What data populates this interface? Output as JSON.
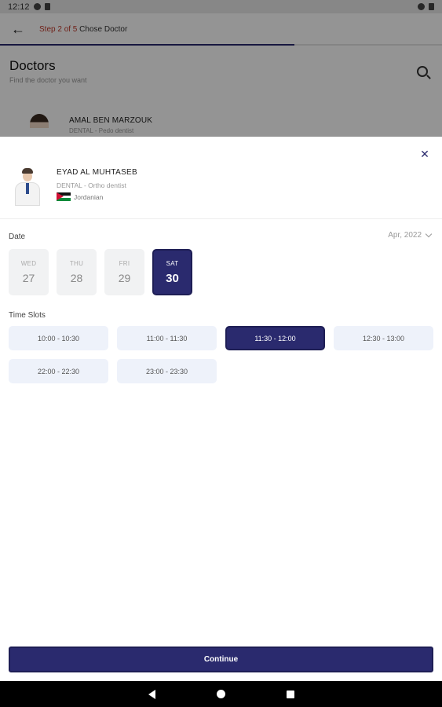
{
  "status_bar": {
    "time": "12:12"
  },
  "top_bar": {
    "step": "Step 2 of 5",
    "step_title": "Chose Doctor"
  },
  "doctors_header": {
    "title": "Doctors",
    "subtitle": "Find the doctor you want"
  },
  "background_doctor": {
    "name": "AMAL BEN MARZOUK",
    "specialty": "DENTAL - Pedo dentist"
  },
  "doctor": {
    "name": "EYAD AL MUHTASEB",
    "specialty": "DENTAL - Ortho dentist",
    "nationality": "Jordanian"
  },
  "date": {
    "label": "Date",
    "month": "Apr, 2022",
    "days": [
      {
        "name": "WED",
        "number": "27",
        "selected": false
      },
      {
        "name": "THU",
        "number": "28",
        "selected": false
      },
      {
        "name": "FRI",
        "number": "29",
        "selected": false
      },
      {
        "name": "SAT",
        "number": "30",
        "selected": true
      }
    ]
  },
  "time_slots": {
    "label": "Time Slots",
    "slots": [
      {
        "time": "10:00 - 10:30",
        "selected": false
      },
      {
        "time": "11:00 - 11:30",
        "selected": false
      },
      {
        "time": "11:30 - 12:00",
        "selected": true
      },
      {
        "time": "12:30 - 13:00",
        "selected": false
      },
      {
        "time": "22:00 - 22:30",
        "selected": false
      },
      {
        "time": "23:00 - 23:30",
        "selected": false
      }
    ]
  },
  "actions": {
    "continue_label": "Continue"
  },
  "colors": {
    "primary": "#2a2a6e",
    "accent": "#c0392b",
    "slot_bg": "#eef2fa",
    "day_bg": "#f1f2f3"
  },
  "icons": {
    "back": "arrow-left-icon",
    "search": "search-icon",
    "close": "close-icon",
    "month_dropdown": "chevron-down-icon",
    "flag": "jordan-flag-icon"
  }
}
